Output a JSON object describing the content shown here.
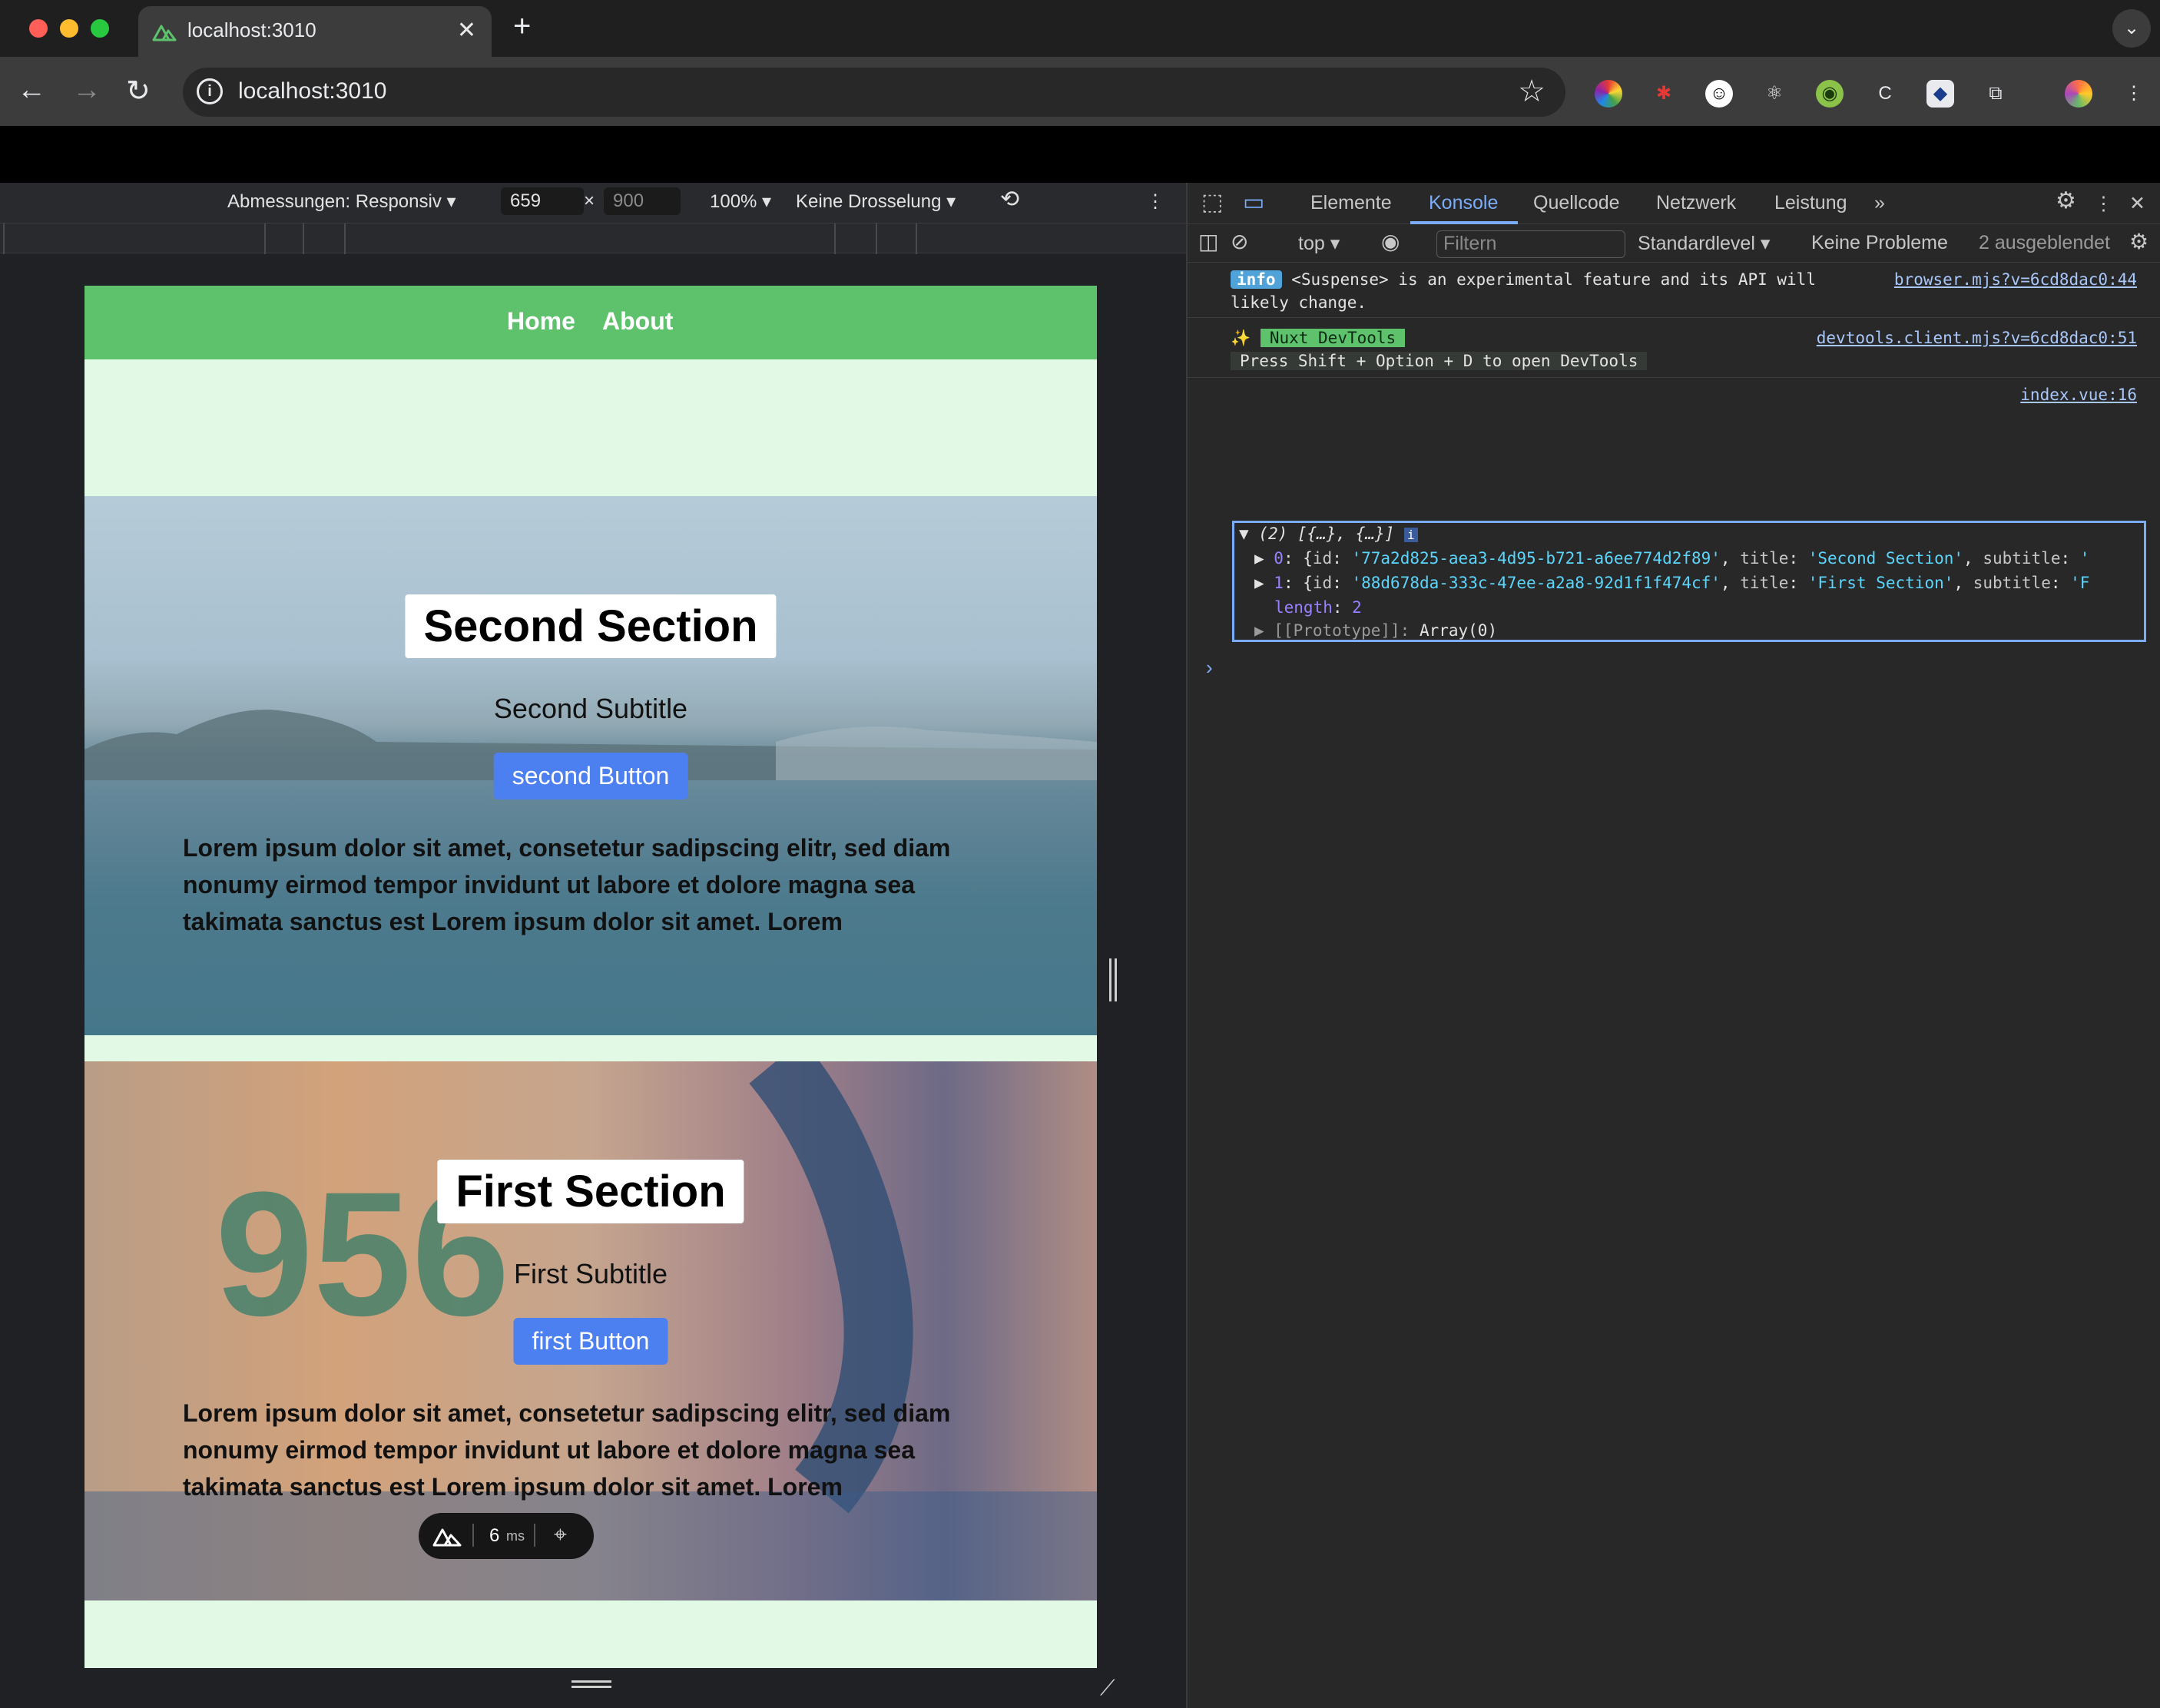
{
  "browser": {
    "tab_title": "localhost:3010",
    "url": "localhost:3010",
    "new_tab": "+",
    "close_tab": "✕"
  },
  "emulation": {
    "dimensions_label": "Abmessungen: Responsiv",
    "width_value": "659",
    "times": "×",
    "height_placeholder": "900",
    "zoom": "100%",
    "throttle": "Keine Drosselung"
  },
  "site": {
    "nav": {
      "home": "Home",
      "about": "About"
    },
    "sections": [
      {
        "title": "Second Section",
        "subtitle": "Second Subtitle",
        "button": "second Button",
        "body": "Lorem ipsum dolor sit amet, consetetur sadipscing elitr, sed diam nonumy eirmod tempor invidunt ut labore et dolore magna sea takimata sanctus est Lorem ipsum dolor sit amet. Lorem"
      },
      {
        "title": "First Section",
        "subtitle": "First Subtitle",
        "button": "first Button",
        "body": "Lorem ipsum dolor sit amet, consetetur sadipscing elitr, sed diam nonumy eirmod tempor invidunt ut labore et dolore magna sea takimata sanctus est Lorem ipsum dolor sit amet. Lorem"
      }
    ],
    "nuxt_badge_time": "6",
    "nuxt_badge_unit": "ms"
  },
  "devtools": {
    "tabs": [
      "Elemente",
      "Konsole",
      "Quellcode",
      "Netzwerk",
      "Leistung"
    ],
    "active_tab": "Konsole",
    "context": "top",
    "filter_placeholder": "Filtern",
    "level": "Standardlevel",
    "issues": "Keine Probleme",
    "hidden": "2 ausgeblendet",
    "messages": {
      "info_tag": "info",
      "info_text_1": "<Suspense> is an experimental feature and its API will",
      "info_text_2": "likely change.",
      "info_src": "browser.mjs?v=6cd8dac0:44",
      "nuxt_tag": "Nuxt DevTools",
      "nuxt_cmd": "Press Shift + Option + D to open DevTools",
      "nuxt_src": "devtools.client.mjs?v=6cd8dac0:51",
      "log_src": "index.vue:16",
      "array_summary": "(2) [{…}, {…}]",
      "item0_id": "'77a2d825-aea3-4d95-b721-a6ee774d2f89'",
      "item0_title": "'Second Section'",
      "item1_id": "'88d678da-333c-47ee-a2a8-92d1f1f474cf'",
      "item1_title": "'First Section'",
      "length_value": "2",
      "prototype": "Array(0)",
      "item1_subtitle_start": "'F",
      "item0_subtitle_start": "'"
    }
  },
  "colors": {
    "nav_green": "#5ec26d",
    "page_bg": "#e2f9e6",
    "button_blue": "#4c7ff0",
    "devtools_accent": "#7cacf8"
  }
}
